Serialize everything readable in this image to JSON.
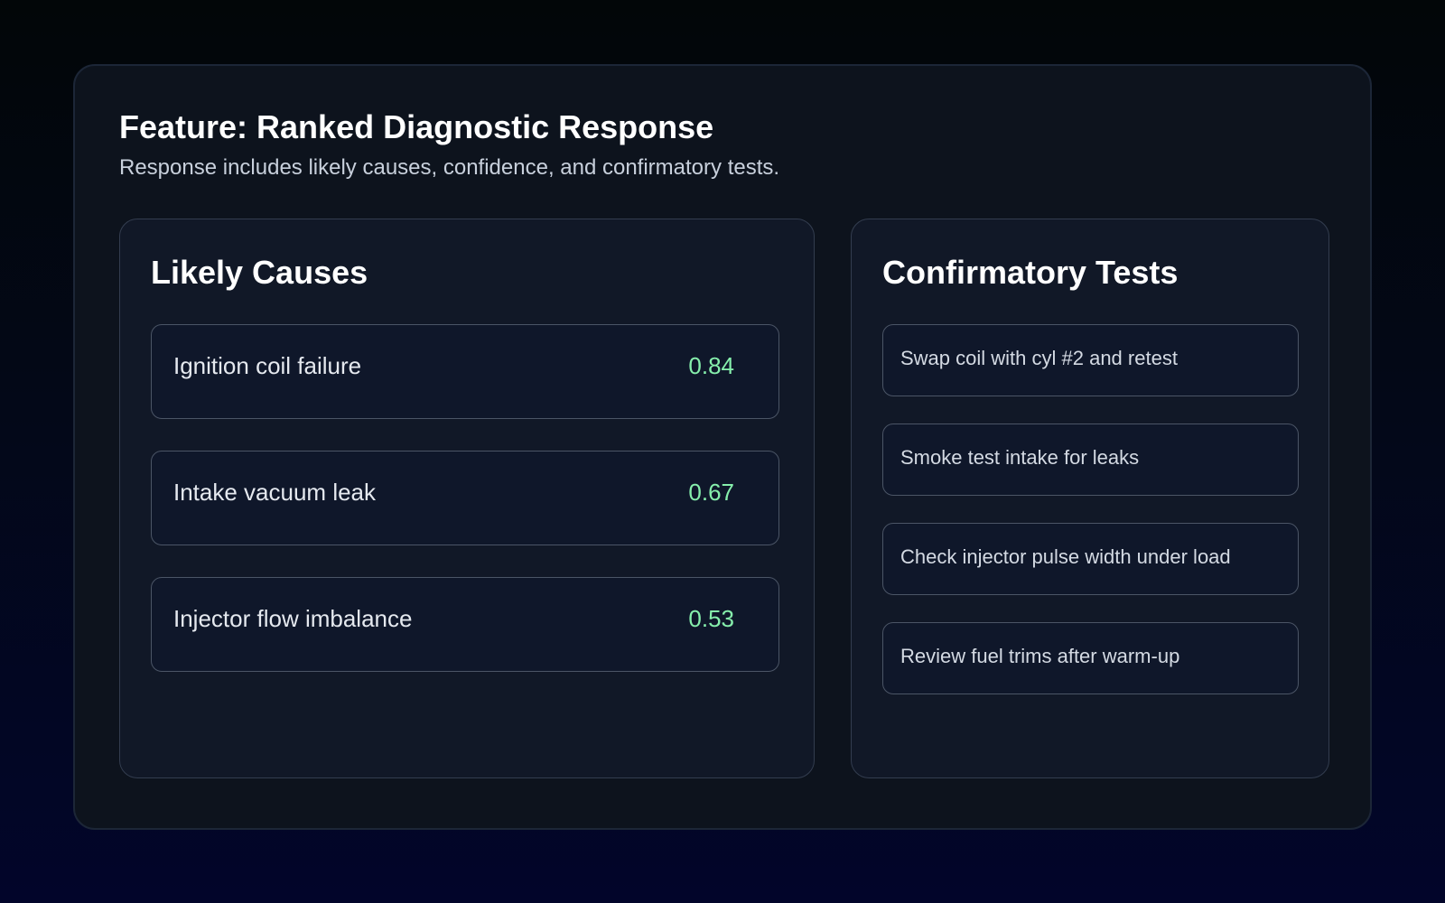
{
  "header": {
    "title": "Feature: Ranked Diagnostic Response",
    "subtitle": "Response includes likely causes, confidence, and confirmatory tests."
  },
  "causes": {
    "title": "Likely Causes",
    "items": [
      {
        "label": "Ignition coil failure",
        "score": "0.84"
      },
      {
        "label": "Intake vacuum leak",
        "score": "0.67"
      },
      {
        "label": "Injector flow imbalance",
        "score": "0.53"
      }
    ]
  },
  "tests": {
    "title": "Confirmatory Tests",
    "items": [
      {
        "label": "Swap coil with cyl #2 and retest"
      },
      {
        "label": "Smoke test intake for leaks"
      },
      {
        "label": "Check injector pulse width under load"
      },
      {
        "label": "Review fuel trims after warm-up"
      }
    ]
  },
  "colors": {
    "score": "#86efac",
    "card_bg": "#0d131d",
    "panel_bg": "#111827",
    "item_bg": "#0f172a"
  }
}
